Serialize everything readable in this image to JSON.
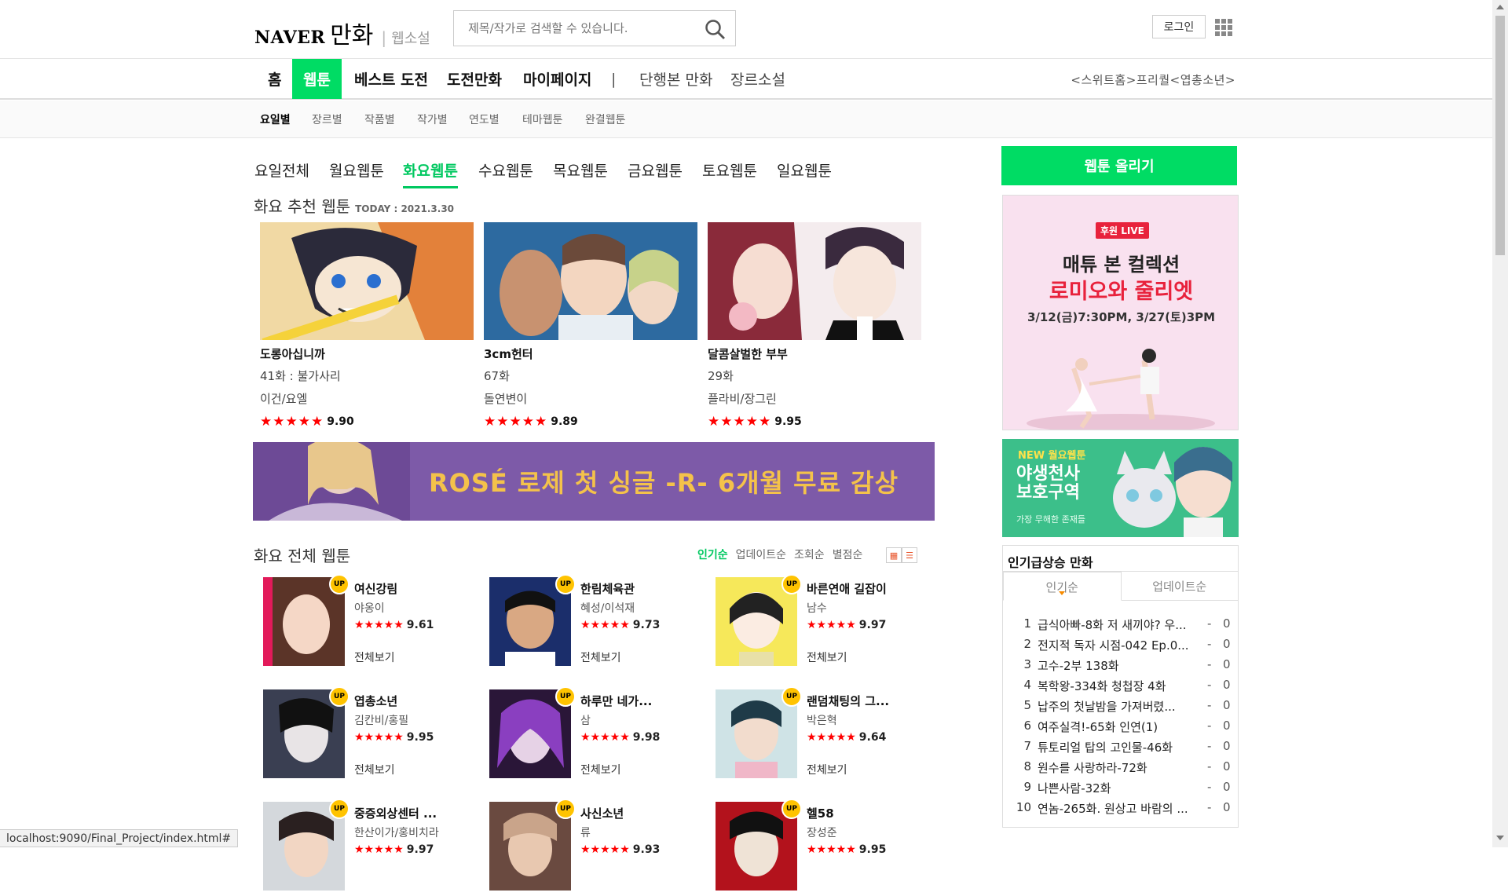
{
  "header": {
    "logo_naver": "NAVER",
    "logo_manhwa": "만화",
    "logo_sep": "|",
    "logo_novel": "웹소설",
    "search_placeholder": "제목/작가로 검색할 수 있습니다.",
    "login": "로그인",
    "search_icon": "search-icon",
    "apps_icon": "grid-icon"
  },
  "main_nav": {
    "items": [
      "홈",
      "웹툰",
      "베스트 도전",
      "도전만화",
      "마이페이지",
      "|",
      "단행본 만화",
      "장르소설"
    ],
    "active": "웹툰",
    "right_text": "<스위트홈>프리퀄<엽총소년>"
  },
  "sub_nav": [
    "요일별",
    "장르별",
    "작품별",
    "작가별",
    "연도별",
    "테마웹툰",
    "완결웹툰"
  ],
  "day_tabs": [
    "요일전체",
    "월요웹툰",
    "화요웹툰",
    "수요웹툰",
    "목요웹툰",
    "금요웹툰",
    "토요웹툰",
    "일요웹툰"
  ],
  "recommend": {
    "title": "화요 추천 웹툰",
    "today": "TODAY : 2021.3.30",
    "cards": [
      {
        "title": "도롱아십니까",
        "episode": "41화 : 불가사리",
        "author": "이건/요엘",
        "stars": "★★★★★",
        "score": "9.90"
      },
      {
        "title": "3cm헌터",
        "episode": "67화",
        "author": "돌연변이",
        "stars": "★★★★★",
        "score": "9.89"
      },
      {
        "title": "달콤살벌한 부부",
        "episode": "29화",
        "author": "플라비/장그린",
        "stars": "★★★★★",
        "score": "9.95"
      }
    ]
  },
  "banner": {
    "text": "ROSÉ 로제 첫 싱글 -R- 6개월 무료 감상"
  },
  "all_webtoon": {
    "title": "화요 전체 웹툰",
    "sort": [
      "인기순",
      "업데이트순",
      "조회순",
      "별점순"
    ],
    "up_badge": "UP",
    "view_all": "전체보기",
    "items": [
      {
        "title": "여신강림",
        "author": "야옹이",
        "stars": "★★★★★",
        "score": "9.61"
      },
      {
        "title": "한림체육관",
        "author": "혜성/이석재",
        "stars": "★★★★★",
        "score": "9.73"
      },
      {
        "title": "바른연애 길잡이",
        "author": "남수",
        "stars": "★★★★★",
        "score": "9.97"
      },
      {
        "title": "엽총소년",
        "author": "김칸비/홍필",
        "stars": "★★★★★",
        "score": "9.95"
      },
      {
        "title": "하루만 네가...",
        "author": "삼",
        "stars": "★★★★★",
        "score": "9.98"
      },
      {
        "title": "랜덤채팅의 그...",
        "author": "박은혁",
        "stars": "★★★★★",
        "score": "9.64"
      },
      {
        "title": "중증외상센터 ...",
        "author": "한산이가/홍비치라",
        "stars": "★★★★★",
        "score": "9.97"
      },
      {
        "title": "사신소년",
        "author": "류",
        "stars": "★★★★★",
        "score": "9.93"
      },
      {
        "title": "헬58",
        "author": "장성준",
        "stars": "★★★★★",
        "score": "9.95"
      }
    ]
  },
  "sidebar": {
    "upload": "웹툰 올리기",
    "ad1": {
      "badge": "후원 LIVE",
      "line1": "매튜 본 컬렉션",
      "line2": "로미오와 줄리엣",
      "line3": "3/12(금)7:30PM, 3/27(토)3PM"
    },
    "ad2": {
      "badge": "NEW 월요웹툰",
      "line1": "야생천사",
      "line2": "보호구역",
      "line3": "가장 무해한 존재들"
    },
    "ranking": {
      "title": "인기급상승 만화",
      "tabs": [
        "인기순",
        "업데이트순"
      ],
      "items": [
        {
          "num": "1",
          "title": "급식아빠-8화 저 새끼야? 우...",
          "dash": "-",
          "count": "0"
        },
        {
          "num": "2",
          "title": "전지적 독자 시점-042 Ep.0...",
          "dash": "-",
          "count": "0"
        },
        {
          "num": "3",
          "title": "고수-2부 138화",
          "dash": "-",
          "count": "0"
        },
        {
          "num": "4",
          "title": "복학왕-334화 청첩장 4화",
          "dash": "-",
          "count": "0"
        },
        {
          "num": "5",
          "title": "납주의 첫날밤을 가져버렸...",
          "dash": "-",
          "count": "0"
        },
        {
          "num": "6",
          "title": "여주실격!-65화 인연(1)",
          "dash": "-",
          "count": "0"
        },
        {
          "num": "7",
          "title": "튜토리얼 탑의 고인물-46화",
          "dash": "-",
          "count": "0"
        },
        {
          "num": "8",
          "title": "원수를 사랑하라-72화",
          "dash": "-",
          "count": "0"
        },
        {
          "num": "9",
          "title": "나쁜사람-32화",
          "dash": "-",
          "count": "0"
        },
        {
          "num": "10",
          "title": "연놈-265화. 원상고 바람의 ...",
          "dash": "-",
          "count": "0"
        }
      ]
    }
  },
  "status_bar": "localhost:9090/Final_Project/index.html#",
  "colors": {
    "brand": "#00dc64",
    "accent_text": "#00c860",
    "star": "#ff0000",
    "banner": "#7d5aa8",
    "up_badge": "#ffc300"
  }
}
